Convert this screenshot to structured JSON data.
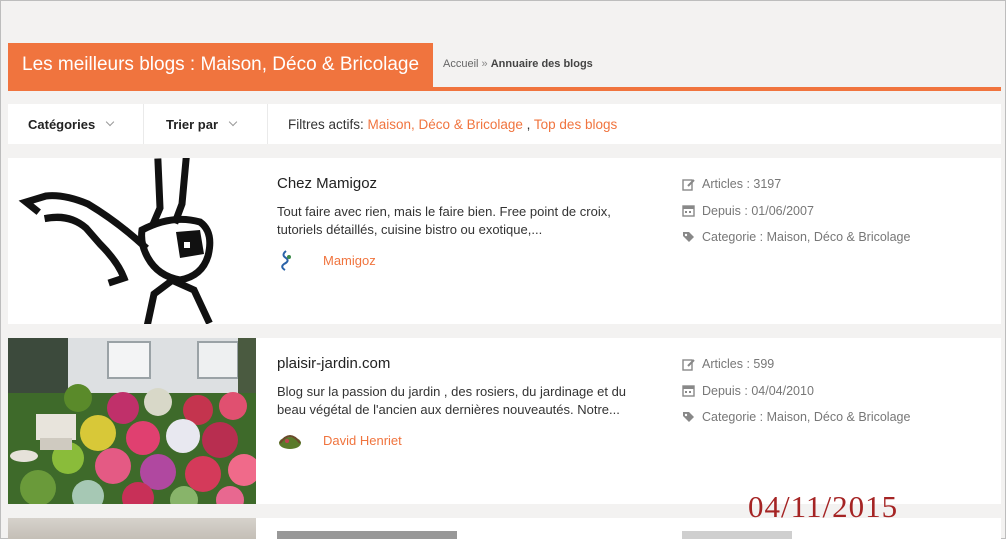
{
  "header": {
    "title": "Les meilleurs blogs : Maison, Déco & Bricolage",
    "breadcrumb_home": "Accueil",
    "breadcrumb_sep": "»",
    "breadcrumb_current": "Annuaire des blogs"
  },
  "filters": {
    "categories_label": "Catégories",
    "sort_label": "Trier par",
    "active_label": "Filtres actifs:",
    "active_1": "Maison, Déco & Bricolage",
    "active_sep": ",",
    "active_2": "Top des blogs"
  },
  "blogs": [
    {
      "title": "Chez Mamigoz",
      "description": "Tout faire avec rien, mais le faire bien. Free point de croix, tutoriels détaillés, cuisine bistro ou exotique,...",
      "author": "Mamigoz",
      "articles": "Articles : 3197",
      "since": "Depuis : 01/06/2007",
      "category": "Categorie : Maison, Déco & Bricolage"
    },
    {
      "title": "plaisir-jardin.com",
      "description": "Blog sur la passion du jardin , des rosiers, du jardinage et du beau végétal de l'ancien aux dernières nouveautés. Notre...",
      "author": "David Henriet",
      "articles": "Articles : 599",
      "since": "Depuis : 04/04/2010",
      "category": "Categorie : Maison, Déco & Bricolage"
    }
  ],
  "stamp_date": "04/11/2015",
  "colors": {
    "accent": "#f0743e",
    "stamp": "#a52424",
    "background": "#f3f2f1"
  }
}
